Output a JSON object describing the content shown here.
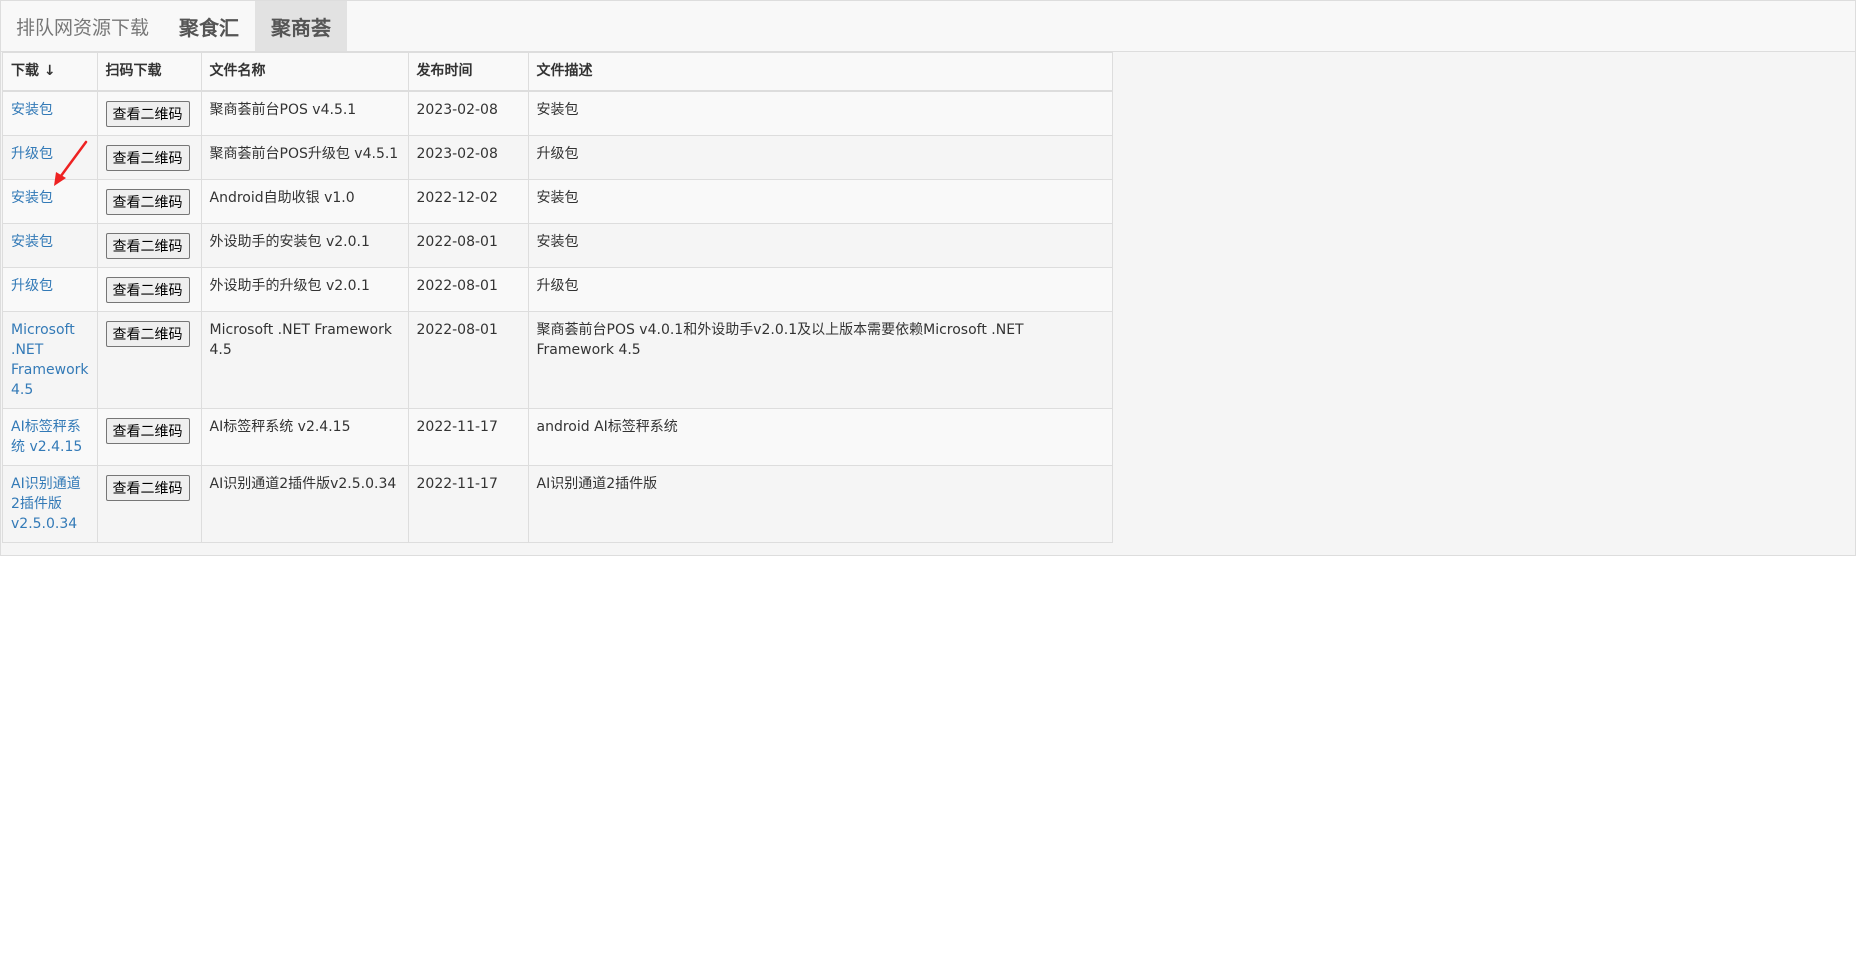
{
  "nav": {
    "brand": "排队网资源下载",
    "items": [
      {
        "label": "聚食汇",
        "active": false
      },
      {
        "label": "聚商荟",
        "active": true
      }
    ]
  },
  "table": {
    "headers": [
      "下载 ↓",
      "扫码下载",
      "文件名称",
      "发布时间",
      "文件描述"
    ],
    "qr_button_label": "查看二维码",
    "rows": [
      {
        "download": "安装包",
        "name": "聚商荟前台POS v4.5.1",
        "date": "2023-02-08",
        "desc": "安装包"
      },
      {
        "download": "升级包",
        "name": "聚商荟前台POS升级包 v4.5.1",
        "date": "2023-02-08",
        "desc": "升级包"
      },
      {
        "download": "安装包",
        "name": "Android自助收银 v1.0",
        "date": "2022-12-02",
        "desc": "安装包"
      },
      {
        "download": "安装包",
        "name": "外设助手的安装包 v2.0.1",
        "date": "2022-08-01",
        "desc": "安装包"
      },
      {
        "download": "升级包",
        "name": "外设助手的升级包 v2.0.1",
        "date": "2022-08-01",
        "desc": "升级包"
      },
      {
        "download": "Microsoft .NET Framework 4.5",
        "name": "Microsoft .NET Framework 4.5",
        "date": "2022-08-01",
        "desc": "聚商荟前台POS v4.0.1和外设助手v2.0.1及以上版本需要依赖Microsoft .NET Framework 4.5"
      },
      {
        "download": "AI标签秤系统 v2.4.15",
        "name": "AI标签秤系统 v2.4.15",
        "date": "2022-11-17",
        "desc": "android AI标签秤系统"
      },
      {
        "download": "AI识别通道2插件版v2.5.0.34",
        "name": "AI识别通道2插件版v2.5.0.34",
        "date": "2022-11-17",
        "desc": "AI识别通道2插件版"
      }
    ]
  },
  "colors": {
    "link": "#337ab7",
    "annotation_arrow": "#ee2222"
  }
}
